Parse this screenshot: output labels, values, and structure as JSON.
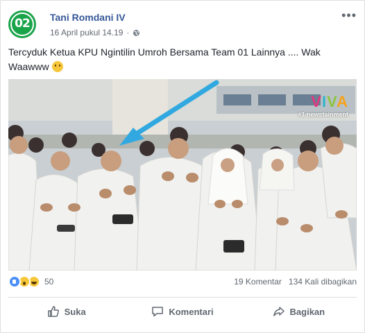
{
  "post": {
    "author": "Tani Romdani IV",
    "timestamp": "16 April pukul 14.19",
    "privacy_icon": "globe-icon",
    "text": "Tercyduk Ketua KPU Ngintilin Umroh Bersama Team 01 Lainnya .... Wak Waawww",
    "text_emoji": "thinking-face-emoji"
  },
  "avatar": {
    "number": "02",
    "color": "#1aa44a"
  },
  "photo": {
    "watermark_logo": [
      "V",
      "I",
      "V",
      "A"
    ],
    "watermark_tag": "#1 newstainment"
  },
  "stats": {
    "reaction_types": [
      "like",
      "wow",
      "haha"
    ],
    "reaction_count": "50",
    "comments": "19 Komentar",
    "shares": "134 Kali dibagikan"
  },
  "actions": {
    "like": "Suka",
    "comment": "Komentari",
    "share": "Bagikan"
  },
  "colors": {
    "link": "#365899",
    "meta": "#616770",
    "arrow": "#31a9e0"
  }
}
